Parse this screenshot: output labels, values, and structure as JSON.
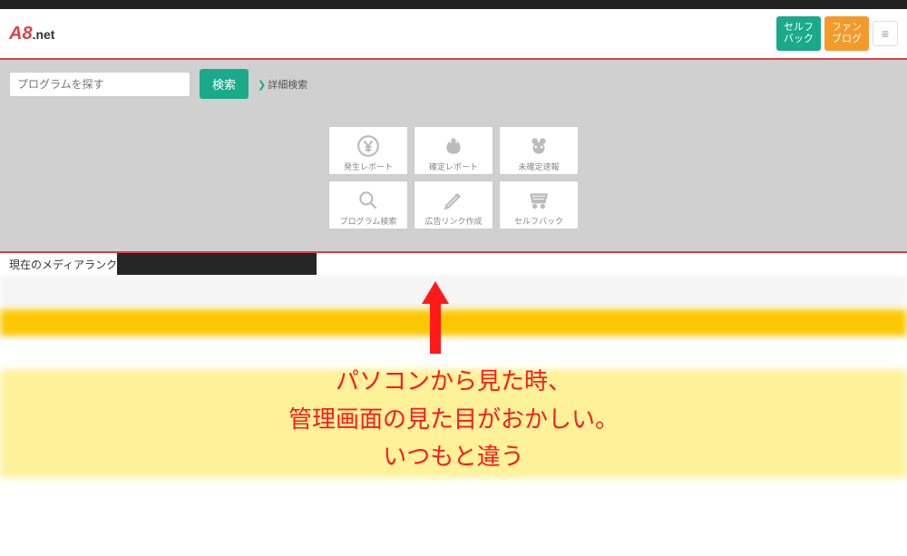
{
  "logo": {
    "brand": "A8",
    "suffix": ".net"
  },
  "header": {
    "selfback": "セルフ\nバック",
    "fanblog": "ファン\nブログ"
  },
  "search": {
    "placeholder": "プログラムを探す",
    "button": "検索",
    "advanced": "詳細検索"
  },
  "tiles": [
    {
      "label": "発生レポート",
      "icon": "yen"
    },
    {
      "label": "確定レポート",
      "icon": "purse"
    },
    {
      "label": "未確定速報",
      "icon": "bug"
    },
    {
      "label": "プログラム検索",
      "icon": "search"
    },
    {
      "label": "広告リンク作成",
      "icon": "pencil"
    },
    {
      "label": "セルフバック",
      "icon": "cart"
    }
  ],
  "rank": {
    "label": "現在のメディアランク"
  },
  "annotation": {
    "line1": "パソコンから見た時、",
    "line2": "管理画面の見た目がおかしい。",
    "line3": "いつもと違う"
  }
}
